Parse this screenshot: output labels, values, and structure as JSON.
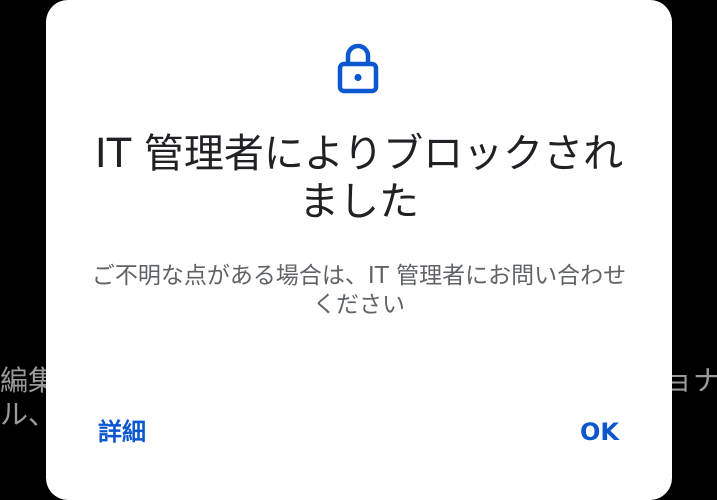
{
  "background": {
    "left_line_1": "編集",
    "left_line_2": "ル、",
    "right_line_1": "ョナ"
  },
  "dialog": {
    "icon": "lock-icon",
    "title": "IT 管理者によりブロックされました",
    "message": "ご不明な点がある場合は、IT 管理者にお問い合わせください",
    "details_button": "詳細",
    "ok_button": "OK"
  },
  "colors": {
    "accent": "#0b57d0",
    "title": "#202124",
    "message": "#5f6368",
    "background": "#000000",
    "dialog": "#ffffff"
  }
}
